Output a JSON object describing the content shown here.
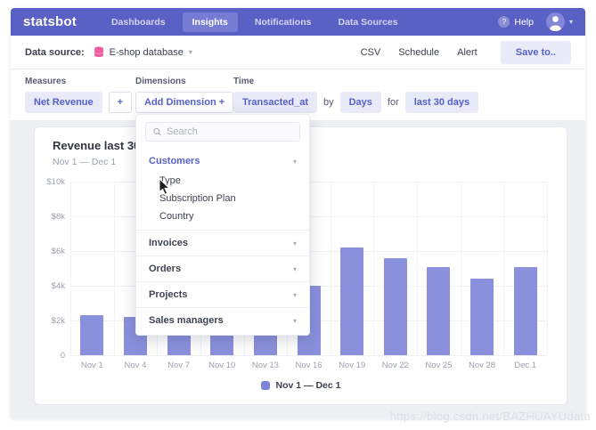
{
  "nav": {
    "logo": "statsbot",
    "items": [
      {
        "label": "Dashboards",
        "active": false
      },
      {
        "label": "Insights",
        "active": true
      },
      {
        "label": "Notifications",
        "active": false
      },
      {
        "label": "Data Sources",
        "active": false
      }
    ],
    "help_label": "Help"
  },
  "toolbar": {
    "data_source_label": "Data source:",
    "data_source_value": "E-shop database",
    "actions": [
      "CSV",
      "Schedule",
      "Alert"
    ],
    "save_button": "Save to.."
  },
  "filters": {
    "measures_label": "Measures",
    "measure_pill": "Net Revenue",
    "add_measure": "+",
    "dimensions_label": "Dimensions",
    "add_dimension_button": "Add Dimension +",
    "time_label": "Time",
    "time_field": "Transacted_at",
    "by_text": "by",
    "granularity": "Days",
    "for_text": "for",
    "range": "last 30 days"
  },
  "dropdown": {
    "search_placeholder": "Search",
    "sections": [
      {
        "label": "Customers",
        "expanded": true,
        "children": [
          "Type",
          "Subscription Plan",
          "Country"
        ]
      },
      {
        "label": "Invoices",
        "expanded": false,
        "children": []
      },
      {
        "label": "Orders",
        "expanded": false,
        "children": []
      },
      {
        "label": "Projects",
        "expanded": false,
        "children": []
      },
      {
        "label": "Sales managers",
        "expanded": false,
        "children": []
      }
    ]
  },
  "chart": {
    "title": "Revenue last 30",
    "subtitle": "Nov 1 — Dec 1",
    "legend": "Nov 1 — Dec 1"
  },
  "chart_data": {
    "type": "bar",
    "title": "Revenue last 30",
    "subtitle": "Nov 1 — Dec 1",
    "categories": [
      "Nov 1",
      "Nov 4",
      "Nov 7",
      "Nov 10",
      "Nov 13",
      "Nov 16",
      "Nov 19",
      "Nov 22",
      "Nov 25",
      "Nov 28",
      "Dec 1"
    ],
    "values": [
      2300,
      2200,
      2200,
      2200,
      2200,
      4000,
      6200,
      5600,
      5100,
      4400,
      5100
    ],
    "unit": "$",
    "xlabel": "",
    "ylabel": "",
    "ylim": [
      0,
      10000
    ],
    "yticks": [
      {
        "value": 10000,
        "label": "$10k"
      },
      {
        "value": 8000,
        "label": "$8k"
      },
      {
        "value": 6000,
        "label": "$6k"
      },
      {
        "value": 4000,
        "label": "$4k"
      },
      {
        "value": 2000,
        "label": "$2k"
      },
      {
        "value": 0,
        "label": "0"
      }
    ],
    "grid": true,
    "legend": [
      {
        "label": "Nov 1 — Dec 1",
        "color": "#7d84d8"
      }
    ],
    "legend_position": "bottom",
    "bar_color": "#8a90dc"
  },
  "watermark": "https://blog.csdn.net/BAZHUAYUdata",
  "colors": {
    "nav_bg": "#5a61c4",
    "nav_active_bg": "#767cd3",
    "accent": "#5660c8",
    "pill_bg": "#e8eaf8",
    "bar": "#8a90dc",
    "content_bg": "#eef0f4",
    "pink_icon": "#ee5c9c"
  }
}
